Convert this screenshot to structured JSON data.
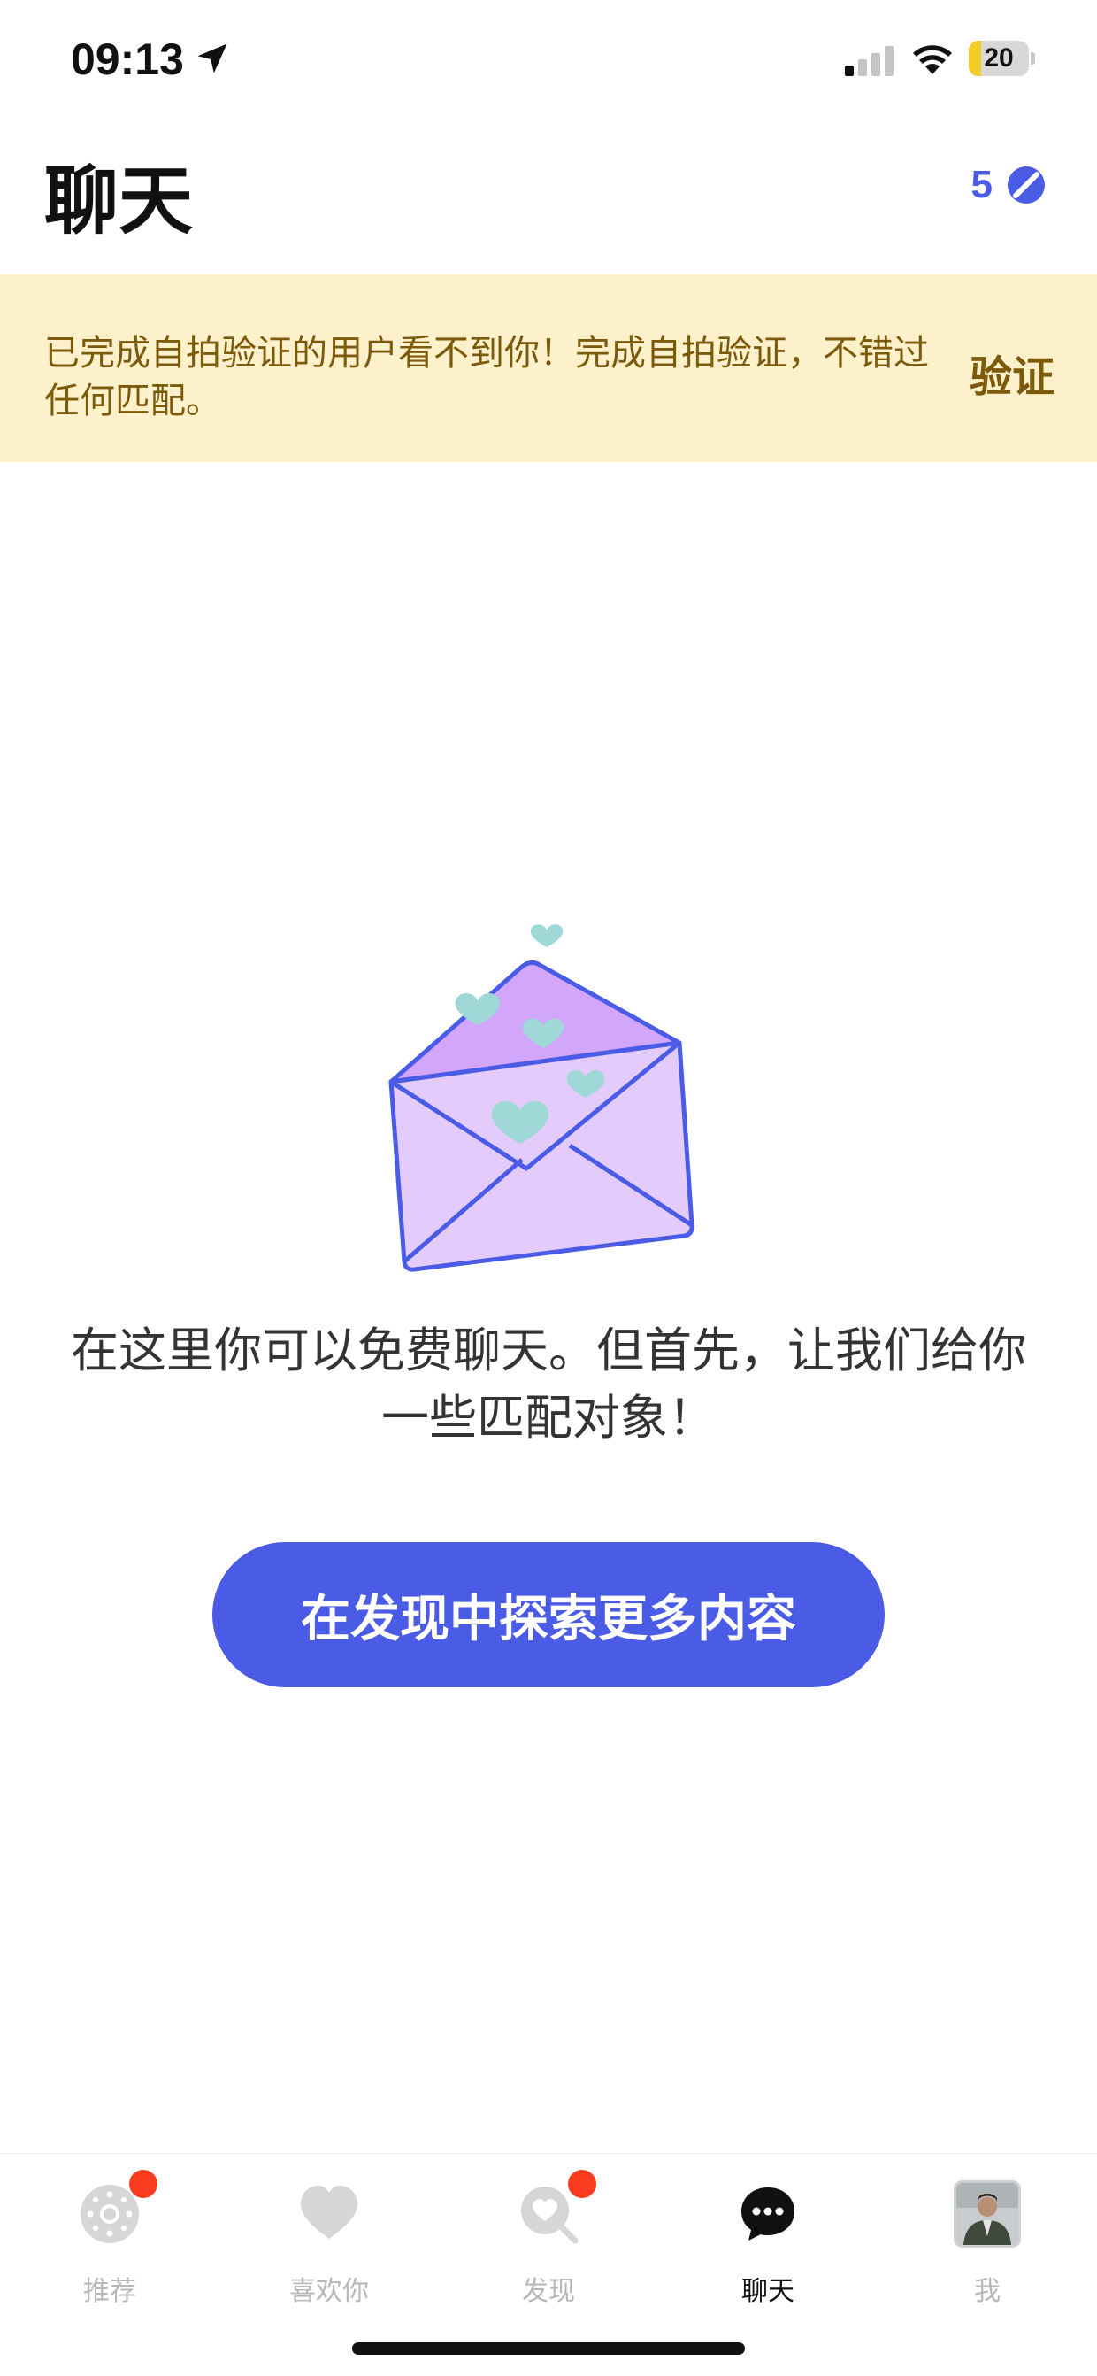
{
  "status_bar": {
    "time": "09:13",
    "battery": "20",
    "battery_level": 0.2,
    "icons": [
      "location-arrow-icon",
      "cellular-signal-icon",
      "wifi-icon",
      "battery-charging-icon"
    ]
  },
  "header": {
    "title": "聊天",
    "likes_count": "5",
    "likes_icon": "superlike-icon"
  },
  "verify_banner": {
    "message": "已完成自拍验证的用户看不到你！完成自拍验证，不错过任何匹配。",
    "action_label": "验证"
  },
  "empty_state": {
    "illustration": "envelope-hearts-illustration",
    "message": "在这里你可以免费聊天。但首先，让我们给你一些匹配对象！",
    "button_label": "在发现中探索更多内容"
  },
  "tab_bar": {
    "tabs": [
      {
        "label": "推荐",
        "icon": "recommend-icon",
        "has_badge": true,
        "active": false
      },
      {
        "label": "喜欢你",
        "icon": "heart-icon",
        "has_badge": false,
        "active": false
      },
      {
        "label": "发现",
        "icon": "discover-icon",
        "has_badge": true,
        "active": false
      },
      {
        "label": "聊天",
        "icon": "chat-icon",
        "has_badge": false,
        "active": true
      },
      {
        "label": "我",
        "icon": "avatar",
        "has_badge": false,
        "active": false
      }
    ]
  },
  "colors": {
    "accent": "#4a5be6",
    "banner_bg": "#fdf1cb",
    "banner_text": "#7b5a0c",
    "badge": "#fb3b1e",
    "envelope_fill": "#e3ccfb",
    "envelope_flap": "#d1a6fb",
    "envelope_stroke": "#4a5be6",
    "hearts": "#9fd8d6"
  }
}
